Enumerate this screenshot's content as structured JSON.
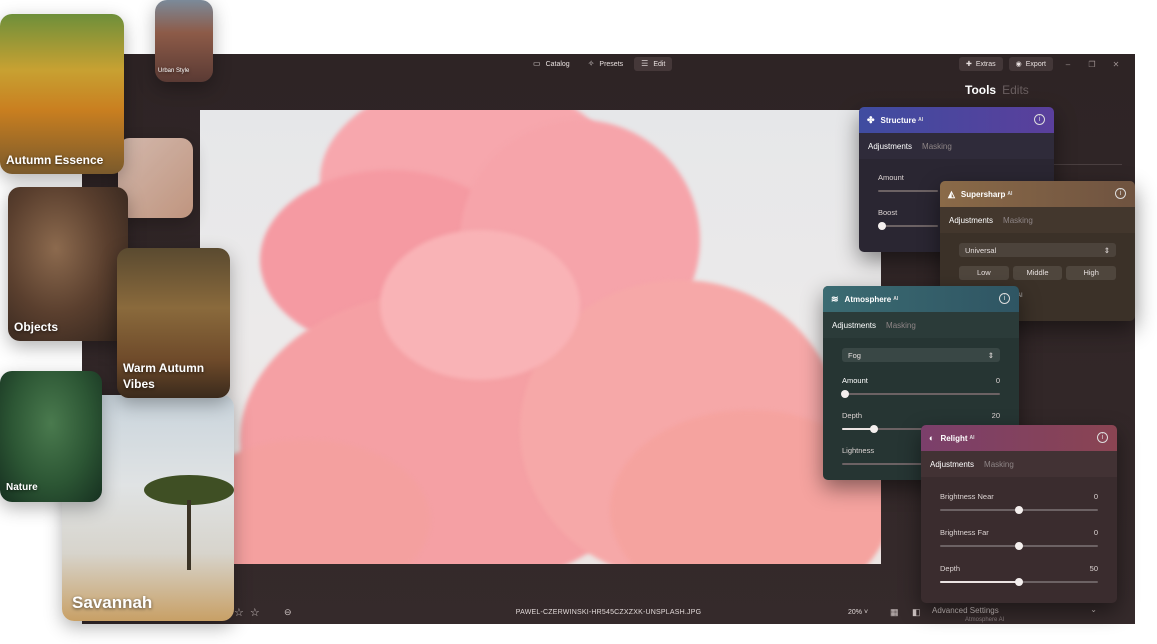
{
  "topbar": {
    "nav": [
      {
        "label": "Catalog",
        "icon": "folder-icon"
      },
      {
        "label": "Presets",
        "icon": "sparkle-icon"
      },
      {
        "label": "Edit",
        "icon": "menu-lines-icon"
      }
    ],
    "extras_label": "Extras",
    "export_label": "Export"
  },
  "tools": {
    "title": "Tools",
    "edits_label": "Edits"
  },
  "cards": [
    {
      "label": "Autumn Essence"
    },
    {
      "label": "Urban Style"
    },
    {
      "label": "Objects"
    },
    {
      "label": "Warm Autumn Vibes"
    },
    {
      "label": "Nature"
    },
    {
      "label": "Savannah"
    }
  ],
  "panels": {
    "structure": {
      "title": "Structure",
      "ai": "AI",
      "tabs": [
        "Adjustments",
        "Masking"
      ],
      "sliders": [
        {
          "label": "Amount"
        },
        {
          "label": "Boost"
        }
      ]
    },
    "supersharp": {
      "title": "Supersharp",
      "ai": "AI",
      "tabs": [
        "Adjustments",
        "Masking"
      ],
      "select": "Universal",
      "options": [
        "Low",
        "Middle",
        "High"
      ],
      "partial": "AI"
    },
    "atmosphere": {
      "title": "Atmosphere",
      "ai": "AI",
      "tabs": [
        "Adjustments",
        "Masking"
      ],
      "select": "Fog",
      "sliders": [
        {
          "label": "Amount",
          "value": "0",
          "level": 0.02
        },
        {
          "label": "Depth",
          "value": "20",
          "level": 0.2
        },
        {
          "label": "Lightness",
          "value": "",
          "level": 0.5
        }
      ]
    },
    "relight": {
      "title": "Relight",
      "ai": "AI",
      "tabs": [
        "Adjustments",
        "Masking"
      ],
      "sliders": [
        {
          "label": "Brightness Near",
          "value": "0",
          "level": 0.5
        },
        {
          "label": "Brightness Far",
          "value": "0",
          "level": 0.5
        },
        {
          "label": "Depth",
          "value": "50",
          "level": 0.5
        }
      ]
    }
  },
  "bottombar": {
    "filename": "PAWEL-CZERWINSKI-HR545CZXZXK-UNSPLASH.JPG",
    "zoom": "20% ˅",
    "advanced_label": "Advanced Settings",
    "partial_label": "Atmosphere AI"
  }
}
